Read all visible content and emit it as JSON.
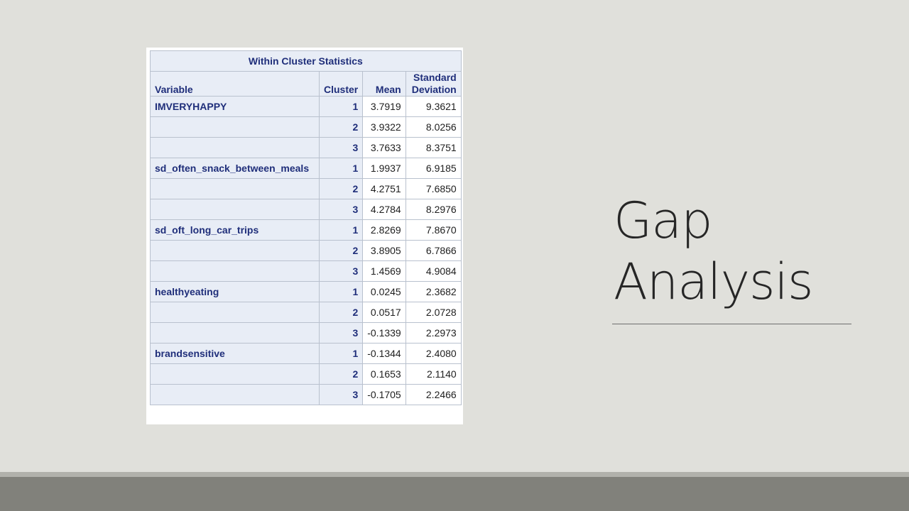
{
  "slide": {
    "title_line1": "Gap",
    "title_line2": "Analysis"
  },
  "table": {
    "caption": "Within Cluster Statistics",
    "headers": {
      "variable": "Variable",
      "cluster": "Cluster",
      "mean": "Mean",
      "std_line1": "Standard",
      "std_line2": "Deviation"
    },
    "rows": [
      {
        "variable": "IMVERYHAPPY",
        "cluster": "1",
        "mean": "3.7919",
        "std": "9.3621"
      },
      {
        "variable": "",
        "cluster": "2",
        "mean": "3.9322",
        "std": "8.0256"
      },
      {
        "variable": "",
        "cluster": "3",
        "mean": "3.7633",
        "std": "8.3751"
      },
      {
        "variable": "sd_often_snack_between_meals",
        "cluster": "1",
        "mean": "1.9937",
        "std": "6.9185"
      },
      {
        "variable": "",
        "cluster": "2",
        "mean": "4.2751",
        "std": "7.6850"
      },
      {
        "variable": "",
        "cluster": "3",
        "mean": "4.2784",
        "std": "8.2976"
      },
      {
        "variable": "sd_oft_long_car_trips",
        "cluster": "1",
        "mean": "2.8269",
        "std": "7.8670"
      },
      {
        "variable": "",
        "cluster": "2",
        "mean": "3.8905",
        "std": "6.7866"
      },
      {
        "variable": "",
        "cluster": "3",
        "mean": "1.4569",
        "std": "4.9084"
      },
      {
        "variable": "healthyeating",
        "cluster": "1",
        "mean": "0.0245",
        "std": "2.3682"
      },
      {
        "variable": "",
        "cluster": "2",
        "mean": "0.0517",
        "std": "2.0728"
      },
      {
        "variable": "",
        "cluster": "3",
        "mean": "-0.1339",
        "std": "2.2973"
      },
      {
        "variable": "brandsensitive",
        "cluster": "1",
        "mean": "-0.1344",
        "std": "2.4080"
      },
      {
        "variable": "",
        "cluster": "2",
        "mean": "0.1653",
        "std": "2.1140"
      },
      {
        "variable": "",
        "cluster": "3",
        "mean": "-0.1705",
        "std": "2.2466"
      }
    ]
  },
  "colors": {
    "background": "#e0e0db",
    "header_text": "#1f2e7a",
    "header_fill": "#e8edf6",
    "footer_band": "#81817b"
  }
}
